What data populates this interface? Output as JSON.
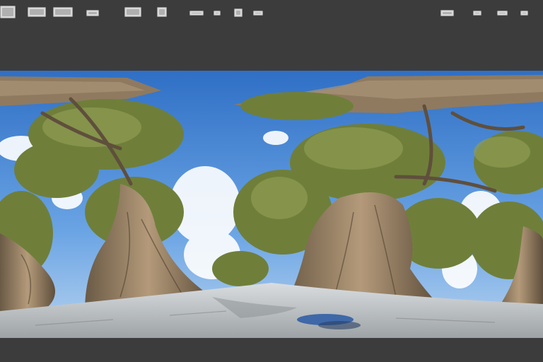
{
  "toolbar": {
    "left_icons": [
      "view-icon",
      "photo-icon",
      "camera-icon",
      "settings-icon",
      "image-icon",
      "layers-icon",
      "folder-icon",
      "tag-icon",
      "crop-icon",
      "export-icon"
    ],
    "right_icons": [
      "share-icon",
      "info-icon",
      "fullscreen-icon",
      "menu-icon"
    ]
  },
  "viewport": {
    "content": "panorama-image",
    "sky_color": "#4f8fd8",
    "ground_color": "#c8cdd0"
  }
}
